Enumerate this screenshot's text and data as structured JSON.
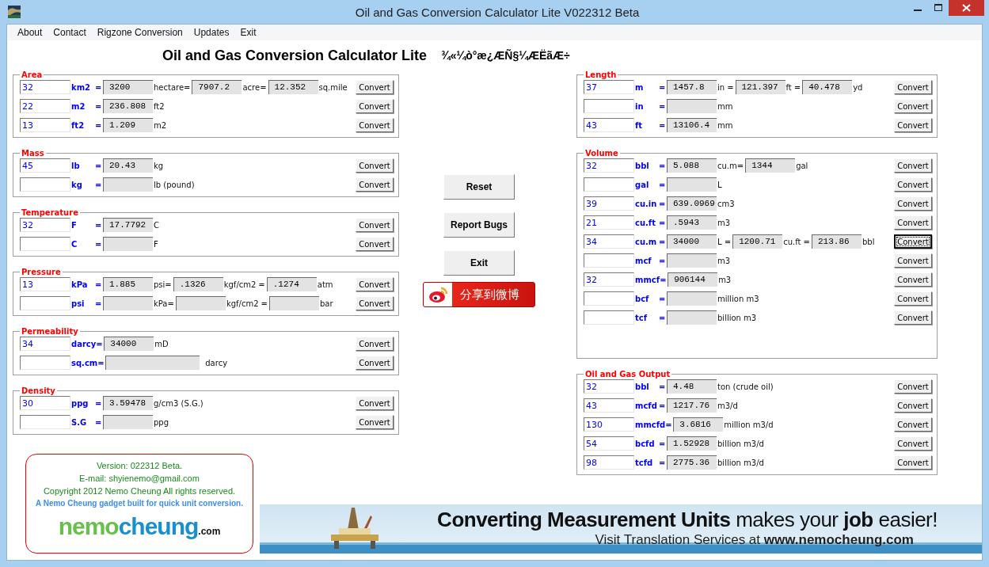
{
  "window": {
    "title": "Oil and Gas Conversion Calculator Lite V022312 Beta"
  },
  "menu": [
    "About",
    "Contact",
    "Rigzone Conversion",
    "Updates",
    "Exit"
  ],
  "heading": {
    "title": "Oil and Gas Conversion Calculator Lite",
    "subtitle": "¾«¼ò°æ¿ÆÑ§¼ÆËãÆ÷"
  },
  "left_groups": [
    {
      "title": "Area",
      "rows": [
        {
          "value": "32",
          "unit": "km2",
          "items": [
            {
              "kind": "sign",
              "text": "="
            },
            {
              "kind": "output",
              "value": "3200"
            },
            {
              "kind": "text",
              "text": "hectare="
            },
            {
              "kind": "output",
              "value": "7907.2"
            },
            {
              "kind": "text",
              "text": "acre="
            },
            {
              "kind": "output",
              "value": "12.352"
            },
            {
              "kind": "text",
              "text": "sq.mile"
            }
          ],
          "button": "Convert"
        },
        {
          "value": "22",
          "unit": "m2",
          "items": [
            {
              "kind": "sign",
              "text": "="
            },
            {
              "kind": "output",
              "value": "236.808"
            },
            {
              "kind": "text",
              "text": "ft2"
            }
          ],
          "button": "Convert"
        },
        {
          "value": "13",
          "unit": "ft2",
          "items": [
            {
              "kind": "sign",
              "text": "="
            },
            {
              "kind": "output",
              "value": "1.209"
            },
            {
              "kind": "text",
              "text": "m2"
            }
          ],
          "button": "Convert"
        }
      ]
    },
    {
      "title": "Mass",
      "rows": [
        {
          "value": "45",
          "unit": "lb",
          "items": [
            {
              "kind": "sign",
              "text": "="
            },
            {
              "kind": "output",
              "value": "20.43"
            },
            {
              "kind": "text",
              "text": "kg"
            }
          ],
          "button": "Convert"
        },
        {
          "unit": "kg",
          "items": [
            {
              "kind": "sign",
              "text": "="
            },
            {
              "kind": "output"
            },
            {
              "kind": "text",
              "text": "lb (pound)"
            }
          ],
          "button": "Convert"
        }
      ]
    },
    {
      "title": "Temperature",
      "rows": [
        {
          "value": "32",
          "unit": "F",
          "items": [
            {
              "kind": "sign",
              "text": "="
            },
            {
              "kind": "output",
              "value": "17.7792"
            },
            {
              "kind": "text",
              "text": "C"
            }
          ],
          "button": "Convert"
        },
        {
          "unit": "C",
          "items": [
            {
              "kind": "sign",
              "text": "="
            },
            {
              "kind": "output"
            },
            {
              "kind": "text",
              "text": "F"
            }
          ],
          "button": "Convert"
        }
      ]
    },
    {
      "title": "Pressure",
      "rows": [
        {
          "value": "13",
          "unit": "kPa",
          "items": [
            {
              "kind": "sign",
              "text": "="
            },
            {
              "kind": "output",
              "value": "1.885"
            },
            {
              "kind": "text",
              "text": "psi="
            },
            {
              "kind": "output",
              "value": ".1326"
            },
            {
              "kind": "text",
              "text": "kgf/cm2"
            },
            {
              "kind": "text",
              "text": "="
            },
            {
              "kind": "output",
              "value": ".1274"
            },
            {
              "kind": "text",
              "text": "atm"
            }
          ],
          "button": "Convert"
        },
        {
          "unit": "psi",
          "items": [
            {
              "kind": "sign",
              "text": "="
            },
            {
              "kind": "output"
            },
            {
              "kind": "text",
              "text": "kPa="
            },
            {
              "kind": "output"
            },
            {
              "kind": "text",
              "text": "kgf/cm2"
            },
            {
              "kind": "text",
              "text": "="
            },
            {
              "kind": "output"
            },
            {
              "kind": "text",
              "text": "bar"
            }
          ],
          "button": "Convert"
        }
      ]
    },
    {
      "title": "Permeability",
      "rows": [
        {
          "value": "34",
          "unit": "darcy",
          "items": [
            {
              "kind": "sign",
              "text": "="
            },
            {
              "kind": "output",
              "value": "34000"
            },
            {
              "kind": "text",
              "text": "mD"
            }
          ],
          "button": "Convert"
        },
        {
          "unit": "sq.cm",
          "items": [
            {
              "kind": "sign",
              "text": "="
            },
            {
              "kind": "wide-output"
            },
            {
              "kind": "text",
              "text": "darcy"
            }
          ],
          "button": "Convert"
        }
      ]
    },
    {
      "title": "Density",
      "rows": [
        {
          "value": "30",
          "unit": "ppg",
          "items": [
            {
              "kind": "sign",
              "text": "="
            },
            {
              "kind": "output",
              "value": "3.59478"
            },
            {
              "kind": "text",
              "text": "g/cm3 (S.G.)"
            }
          ],
          "button": "Convert"
        },
        {
          "unit": "S.G",
          "items": [
            {
              "kind": "sign",
              "text": "="
            },
            {
              "kind": "output"
            },
            {
              "kind": "text",
              "text": "ppg"
            }
          ],
          "button": "Convert"
        }
      ]
    }
  ],
  "actions": [
    "Reset",
    "Report Bugs",
    "Exit"
  ],
  "share_button": "分享到微博",
  "right_groups": [
    {
      "title": "Length",
      "rows": [
        {
          "value": "37",
          "unit": "m",
          "items": [
            {
              "kind": "sign",
              "text": "="
            },
            {
              "kind": "output",
              "value": "1457.8"
            },
            {
              "kind": "text",
              "text": "in"
            },
            {
              "kind": "text",
              "text": "="
            },
            {
              "kind": "output",
              "value": "121.397"
            },
            {
              "kind": "text",
              "text": "ft"
            },
            {
              "kind": "text",
              "text": "="
            },
            {
              "kind": "output",
              "value": "40.478"
            },
            {
              "kind": "text",
              "text": "yd"
            }
          ],
          "button": "Convert"
        },
        {
          "unit": "in",
          "items": [
            {
              "kind": "sign",
              "text": "="
            },
            {
              "kind": "output"
            },
            {
              "kind": "text",
              "text": "mm"
            }
          ],
          "button": "Convert"
        },
        {
          "value": "43",
          "unit": "ft",
          "items": [
            {
              "kind": "sign",
              "text": "="
            },
            {
              "kind": "output",
              "value": "13106.4"
            },
            {
              "kind": "text",
              "text": "mm"
            }
          ],
          "button": "Convert"
        }
      ]
    },
    {
      "title": "Volume",
      "rows": [
        {
          "value": "32",
          "unit": "bbl",
          "items": [
            {
              "kind": "sign",
              "text": "="
            },
            {
              "kind": "output",
              "value": "5.088"
            },
            {
              "kind": "text",
              "text": "cu.m="
            },
            {
              "kind": "output",
              "value": "1344"
            },
            {
              "kind": "text",
              "text": "gal"
            }
          ],
          "button": "Convert",
          "focused": false
        },
        {
          "unit": "gal",
          "items": [
            {
              "kind": "sign",
              "text": "="
            },
            {
              "kind": "output"
            },
            {
              "kind": "text",
              "text": "L"
            }
          ],
          "button": "Convert",
          "focused": false
        },
        {
          "value": "39",
          "unit": "cu.in",
          "items": [
            {
              "kind": "sign",
              "text": "="
            },
            {
              "kind": "output",
              "value": "639.0969"
            },
            {
              "kind": "text",
              "text": "cm3"
            }
          ],
          "button": "Convert",
          "focused": false
        },
        {
          "value": "21",
          "unit": "cu.ft",
          "items": [
            {
              "kind": "sign",
              "text": "="
            },
            {
              "kind": "output",
              "value": ".5943"
            },
            {
              "kind": "text",
              "text": "m3"
            }
          ],
          "button": "Convert",
          "focused": false
        },
        {
          "value": "34",
          "unit": "cu.m",
          "items": [
            {
              "kind": "sign",
              "text": "="
            },
            {
              "kind": "output",
              "value": "34000"
            },
            {
              "kind": "text",
              "text": "L ="
            },
            {
              "kind": "output",
              "value": "1200.71"
            },
            {
              "kind": "text",
              "text": "cu.ft ="
            },
            {
              "kind": "output",
              "value": "213.86"
            },
            {
              "kind": "text",
              "text": "bbl"
            }
          ],
          "button": "Convert",
          "focused": true
        },
        {
          "unit": "mcf",
          "items": [
            {
              "kind": "sign",
              "text": "="
            },
            {
              "kind": "output"
            },
            {
              "kind": "text",
              "text": "m3"
            }
          ],
          "button": "Convert",
          "focused": false
        },
        {
          "value": "32",
          "unit": "mmcf",
          "items": [
            {
              "kind": "sign",
              "text": "="
            },
            {
              "kind": "output",
              "value": "906144"
            },
            {
              "kind": "text",
              "text": "m3"
            }
          ],
          "button": "Convert",
          "focused": false
        },
        {
          "unit": "bcf",
          "items": [
            {
              "kind": "sign",
              "text": "="
            },
            {
              "kind": "output"
            },
            {
              "kind": "text",
              "text": "million m3"
            }
          ],
          "button": "Convert",
          "focused": false
        },
        {
          "unit": "tcf",
          "items": [
            {
              "kind": "sign",
              "text": "="
            },
            {
              "kind": "output"
            },
            {
              "kind": "text",
              "text": "billion m3"
            }
          ],
          "button": "Convert",
          "focused": false
        }
      ]
    },
    {
      "title": "Oil and Gas Output",
      "rows": [
        {
          "value": "32",
          "unit": "bbl",
          "items": [
            {
              "kind": "sign",
              "text": "="
            },
            {
              "kind": "output",
              "value": "4.48"
            },
            {
              "kind": "text",
              "text": "ton (crude oil)"
            }
          ],
          "button": "Convert"
        },
        {
          "value": "43",
          "unit": "mcfd",
          "items": [
            {
              "kind": "sign",
              "text": "="
            },
            {
              "kind": "output",
              "value": "1217.76"
            },
            {
              "kind": "text",
              "text": "m3/d"
            }
          ],
          "button": "Convert"
        },
        {
          "value": "130",
          "unit": "mmcfd",
          "items": [
            {
              "kind": "sign",
              "text": "="
            },
            {
              "kind": "output",
              "value": "3.6816"
            },
            {
              "kind": "text",
              "text": "million m3/d"
            }
          ],
          "button": "Convert"
        },
        {
          "value": "54",
          "unit": "bcfd",
          "items": [
            {
              "kind": "sign",
              "text": "="
            },
            {
              "kind": "output",
              "value": "1.52928"
            },
            {
              "kind": "text",
              "text": "billion m3/d"
            }
          ],
          "button": "Convert"
        },
        {
          "value": "98",
          "unit": "tcfd",
          "items": [
            {
              "kind": "sign",
              "text": "="
            },
            {
              "kind": "output",
              "value": "2775.36"
            },
            {
              "kind": "text",
              "text": "billion m3/d"
            }
          ],
          "button": "Convert"
        }
      ]
    }
  ],
  "info": {
    "lines": [
      "Version: 022312 Beta.",
      "E-mail: shyienemo@gmail.com",
      "Copyright 2012 Nemo Cheung All rights reserved."
    ],
    "tagline": "A Nemo Cheung gadget built for quick unit conversion.",
    "logo": [
      {
        "text": "nemo",
        "color": "#66c04a"
      },
      {
        "text": "cheung",
        "color": "#1a8fd0"
      },
      {
        "text": ".com",
        "color": "#111111"
      }
    ]
  },
  "banner": {
    "headline": "**Converting Measurement Units** makes your **job** easier!",
    "subline": "Visit Translation Services at **www.nemocheung.com**"
  }
}
